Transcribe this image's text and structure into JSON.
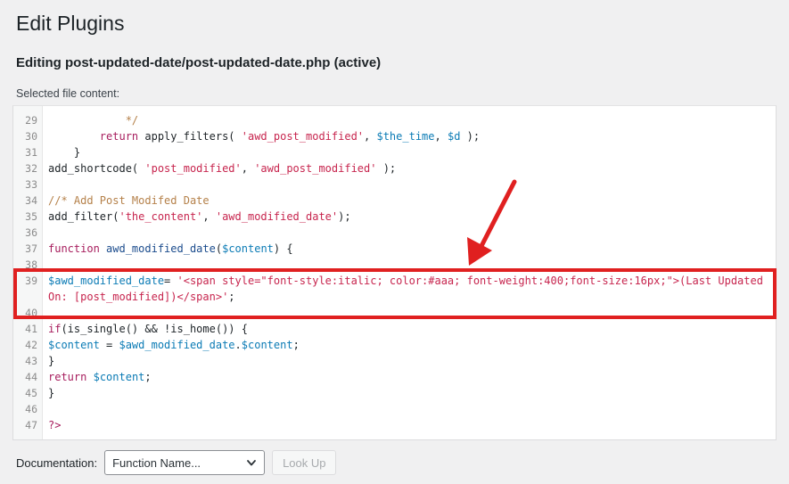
{
  "page": {
    "title": "Edit Plugins",
    "editing_heading": "Editing post-updated-date/post-updated-date.php (active)",
    "file_content_label": "Selected file content:"
  },
  "editor": {
    "first_line_number": 29,
    "last_line_number": 47,
    "lines": [
      {
        "n": "29",
        "segments": [
          {
            "t": "            */",
            "c": "tok-cmt"
          }
        ]
      },
      {
        "n": "30",
        "segments": [
          {
            "t": "        ",
            "c": "tok-pln"
          },
          {
            "t": "return",
            "c": "tok-kw"
          },
          {
            "t": " apply_filters( ",
            "c": "tok-pln"
          },
          {
            "t": "'awd_post_modified'",
            "c": "tok-str"
          },
          {
            "t": ", ",
            "c": "tok-pln"
          },
          {
            "t": "$the_time",
            "c": "tok-var"
          },
          {
            "t": ", ",
            "c": "tok-pln"
          },
          {
            "t": "$d",
            "c": "tok-var"
          },
          {
            "t": " );",
            "c": "tok-pln"
          }
        ]
      },
      {
        "n": "31",
        "segments": [
          {
            "t": "    }",
            "c": "tok-pln"
          }
        ]
      },
      {
        "n": "32",
        "segments": [
          {
            "t": "add_shortcode( ",
            "c": "tok-pln"
          },
          {
            "t": "'post_modified'",
            "c": "tok-str"
          },
          {
            "t": ", ",
            "c": "tok-pln"
          },
          {
            "t": "'awd_post_modified'",
            "c": "tok-str"
          },
          {
            "t": " );",
            "c": "tok-pln"
          }
        ]
      },
      {
        "n": "33",
        "segments": [
          {
            "t": "",
            "c": "tok-pln"
          }
        ]
      },
      {
        "n": "34",
        "segments": [
          {
            "t": "//* Add Post Modifed Date",
            "c": "tok-cmt"
          }
        ]
      },
      {
        "n": "35",
        "segments": [
          {
            "t": "add_filter(",
            "c": "tok-pln"
          },
          {
            "t": "'the_content'",
            "c": "tok-str"
          },
          {
            "t": ", ",
            "c": "tok-pln"
          },
          {
            "t": "'awd_modified_date'",
            "c": "tok-str"
          },
          {
            "t": ");",
            "c": "tok-pln"
          }
        ]
      },
      {
        "n": "36",
        "segments": [
          {
            "t": "",
            "c": "tok-pln"
          }
        ]
      },
      {
        "n": "37",
        "segments": [
          {
            "t": "function",
            "c": "tok-kw"
          },
          {
            "t": " ",
            "c": "tok-pln"
          },
          {
            "t": "awd_modified_date",
            "c": "tok-fn"
          },
          {
            "t": "(",
            "c": "tok-pln"
          },
          {
            "t": "$content",
            "c": "tok-var"
          },
          {
            "t": ") {",
            "c": "tok-pln"
          }
        ]
      },
      {
        "n": "38",
        "segments": [
          {
            "t": "",
            "c": "tok-pln"
          }
        ]
      },
      {
        "n": "39",
        "wrap": true,
        "segments": [
          {
            "t": "$awd_modified_date",
            "c": "tok-var"
          },
          {
            "t": "= ",
            "c": "tok-pln"
          },
          {
            "t": "'<span style=\"font-style:italic; color:#aaa; font-weight:400;font-size:16px;\">(Last Updated On: [post_modified])</span>'",
            "c": "tok-str"
          },
          {
            "t": ";",
            "c": "tok-pln"
          }
        ]
      },
      {
        "n": "40",
        "segments": [
          {
            "t": "",
            "c": "tok-pln"
          }
        ]
      },
      {
        "n": "41",
        "segments": [
          {
            "t": "if",
            "c": "tok-kw"
          },
          {
            "t": "(is_single() && !is_home()) {",
            "c": "tok-pln"
          }
        ]
      },
      {
        "n": "42",
        "segments": [
          {
            "t": "$content",
            "c": "tok-var"
          },
          {
            "t": " = ",
            "c": "tok-pln"
          },
          {
            "t": "$awd_modified_date",
            "c": "tok-var"
          },
          {
            "t": ".",
            "c": "tok-pln"
          },
          {
            "t": "$content",
            "c": "tok-var"
          },
          {
            "t": ";",
            "c": "tok-pln"
          }
        ]
      },
      {
        "n": "43",
        "segments": [
          {
            "t": "}",
            "c": "tok-pln"
          }
        ]
      },
      {
        "n": "44",
        "segments": [
          {
            "t": "return",
            "c": "tok-kw"
          },
          {
            "t": " ",
            "c": "tok-pln"
          },
          {
            "t": "$content",
            "c": "tok-var"
          },
          {
            "t": ";",
            "c": "tok-pln"
          }
        ]
      },
      {
        "n": "45",
        "segments": [
          {
            "t": "}",
            "c": "tok-pln"
          }
        ]
      },
      {
        "n": "46",
        "segments": [
          {
            "t": "",
            "c": "tok-pln"
          }
        ]
      },
      {
        "n": "47",
        "segments": [
          {
            "t": "?>",
            "c": "tok-kw"
          }
        ]
      }
    ]
  },
  "annotations": {
    "highlight_color": "#e02020",
    "highlight_target_line": "39",
    "arrow_color": "#e02020"
  },
  "footer": {
    "documentation_label": "Documentation:",
    "function_select_value": "Function Name...",
    "look_up_label": "Look Up"
  }
}
